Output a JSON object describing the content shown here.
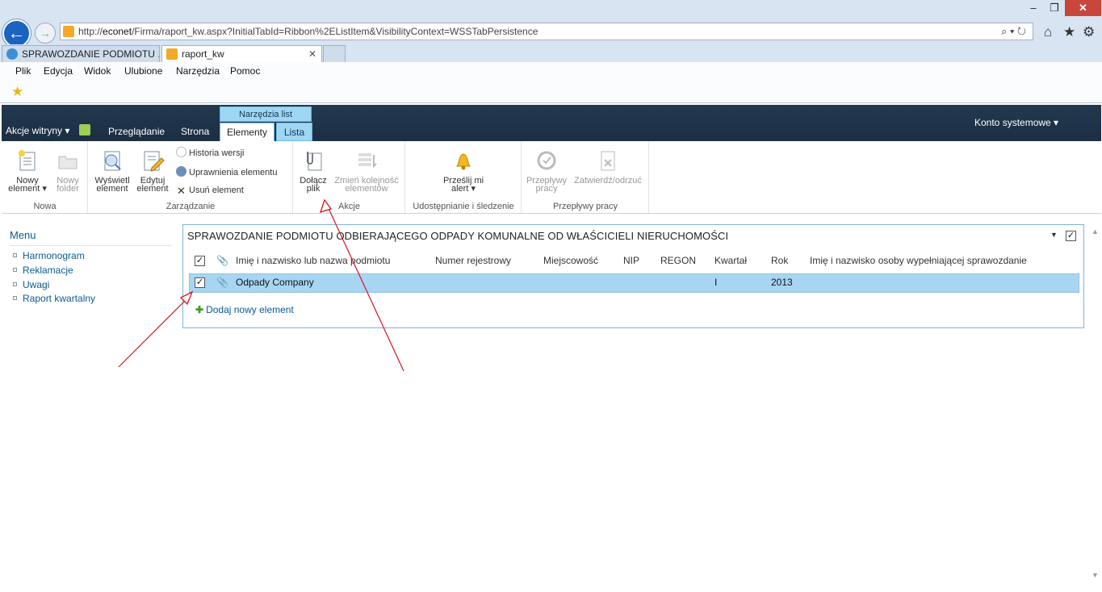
{
  "browser": {
    "url_prefix": "http://",
    "url_host": "econet",
    "url_path": "/Firma/raport_kw.aspx?InitialTabId=Ribbon%2EListItem&VisibilityContext=WSSTabPersistence",
    "tabs": [
      {
        "label": "SPRAWOZDANIE PODMIOTU ..."
      },
      {
        "label": "raport_kw"
      }
    ],
    "menu": [
      "Plik",
      "Edycja",
      "Widok",
      "Ulubione",
      "Narzędzia",
      "Pomoc"
    ],
    "window_controls": {
      "minimize": "–",
      "restore": "❐",
      "close": "✕"
    },
    "addr_tools": "⌕ ▾ ↻"
  },
  "sharepoint": {
    "site_actions": "Akcje witryny",
    "tabs": [
      "Przeglądanie",
      "Strona"
    ],
    "context_group": "Narzędzia list",
    "context_tabs": [
      "Elementy",
      "Lista"
    ],
    "account": "Konto systemowe"
  },
  "ribbon": {
    "groups": [
      "Nowa",
      "Zarządzanie",
      "Akcje",
      "Udostępnianie i śledzenie",
      "Przepływy pracy"
    ],
    "new_item": [
      "Nowy",
      "element"
    ],
    "new_folder": [
      "Nowy",
      "folder"
    ],
    "view_item": [
      "Wyświetl",
      "element"
    ],
    "edit_item": [
      "Edytuj",
      "element"
    ],
    "version_history": "Historia wersji",
    "item_permissions": "Uprawnienia elementu",
    "delete_item": "Usuń element",
    "attach_file": [
      "Dołącz",
      "plik"
    ],
    "reorder": [
      "Zmień kolejność",
      "elementów"
    ],
    "alert_me": [
      "Prześlij mi",
      "alert"
    ],
    "workflows": [
      "Przepływy",
      "pracy"
    ],
    "approve_reject": "Zatwierdź/odrzuć"
  },
  "nav": {
    "header": "Menu",
    "items": [
      "Harmonogram",
      "Reklamacje",
      "Uwagi",
      "Raport kwartalny"
    ]
  },
  "list": {
    "title": "SPRAWOZDANIE PODMIOTU ODBIERAJĄCEGO ODPADY KOMUNALNE OD WŁAŚCICIELI NIERUCHOMOŚCI",
    "columns": [
      "Imię i nazwisko lub nazwa podmiotu",
      "Numer rejestrowy",
      "Miejscowość",
      "NIP",
      "REGON",
      "Kwartał",
      "Rok",
      "Imię i nazwisko osoby wypełniającej sprawozdanie"
    ],
    "rows": [
      {
        "name": "Odpady Company",
        "kwartal": "I",
        "rok": "2013",
        "checked": true
      }
    ],
    "add_new": "Dodaj nowy element"
  },
  "colors": {
    "ribbon_dark": "#1f3549",
    "context_tab": "#9ed6f3",
    "selected_row": "#a8d6f2",
    "link": "#0b5a91",
    "annotation_arrow": "#d9121b"
  }
}
